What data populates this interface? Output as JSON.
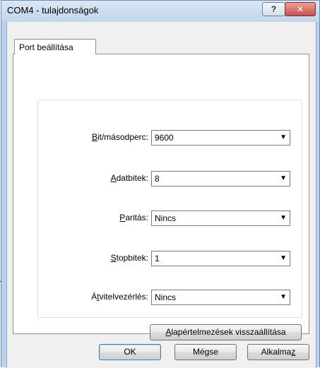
{
  "window": {
    "title": "COM4 - tulajdonságok",
    "help_label": "?",
    "close_label": "✕"
  },
  "tab": {
    "label": "Port beállítása"
  },
  "settings": [
    {
      "label_pre": "",
      "label_accel": "B",
      "label_post": "it/másodperc:",
      "value": "9600"
    },
    {
      "label_pre": "",
      "label_accel": "A",
      "label_post": "datbitek:",
      "value": "8"
    },
    {
      "label_pre": "",
      "label_accel": "P",
      "label_post": "aritás:",
      "value": "Nincs"
    },
    {
      "label_pre": "",
      "label_accel": "S",
      "label_post": "topbitek:",
      "value": "1"
    },
    {
      "label_pre": "Á",
      "label_accel": "t",
      "label_post": "vitelvezérlés:",
      "value": "Nincs"
    }
  ],
  "dropdown_arrow": "▼",
  "restore": {
    "accel": "A",
    "rest": "lapértelmezések visszaállítása"
  },
  "buttons": {
    "ok": "OK",
    "cancel": "Mégse",
    "apply_pre": "Alkalma",
    "apply_accel": "z"
  },
  "colors": {
    "frame": "#b9d1ea",
    "client": "#f0f0f0",
    "close": "#c75050"
  }
}
